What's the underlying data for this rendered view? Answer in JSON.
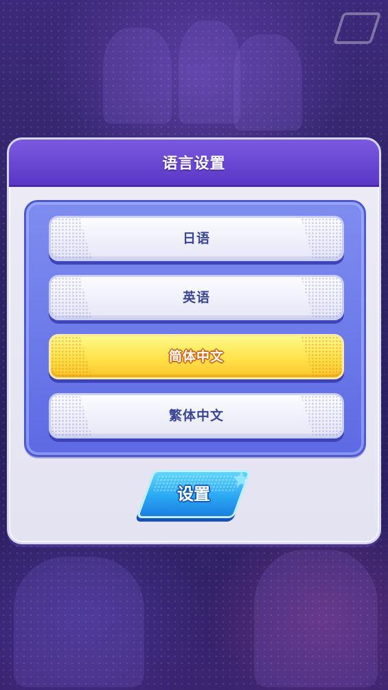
{
  "dialog": {
    "title": "语言设置"
  },
  "language_options": [
    {
      "label": "日语",
      "selected": false
    },
    {
      "label": "英语",
      "selected": false
    },
    {
      "label": "简体中文",
      "selected": true
    },
    {
      "label": "繁体中文",
      "selected": false
    }
  ],
  "set_button": {
    "label": "设置",
    "icon": "star-icon"
  },
  "colors": {
    "header": "#6a47d4",
    "options_frame": "#6f7cec",
    "selected_option": "#ffe24a",
    "normal_option": "#f1f1fb",
    "option_text": "#3a4597",
    "set_button": "#2aa8f4"
  }
}
